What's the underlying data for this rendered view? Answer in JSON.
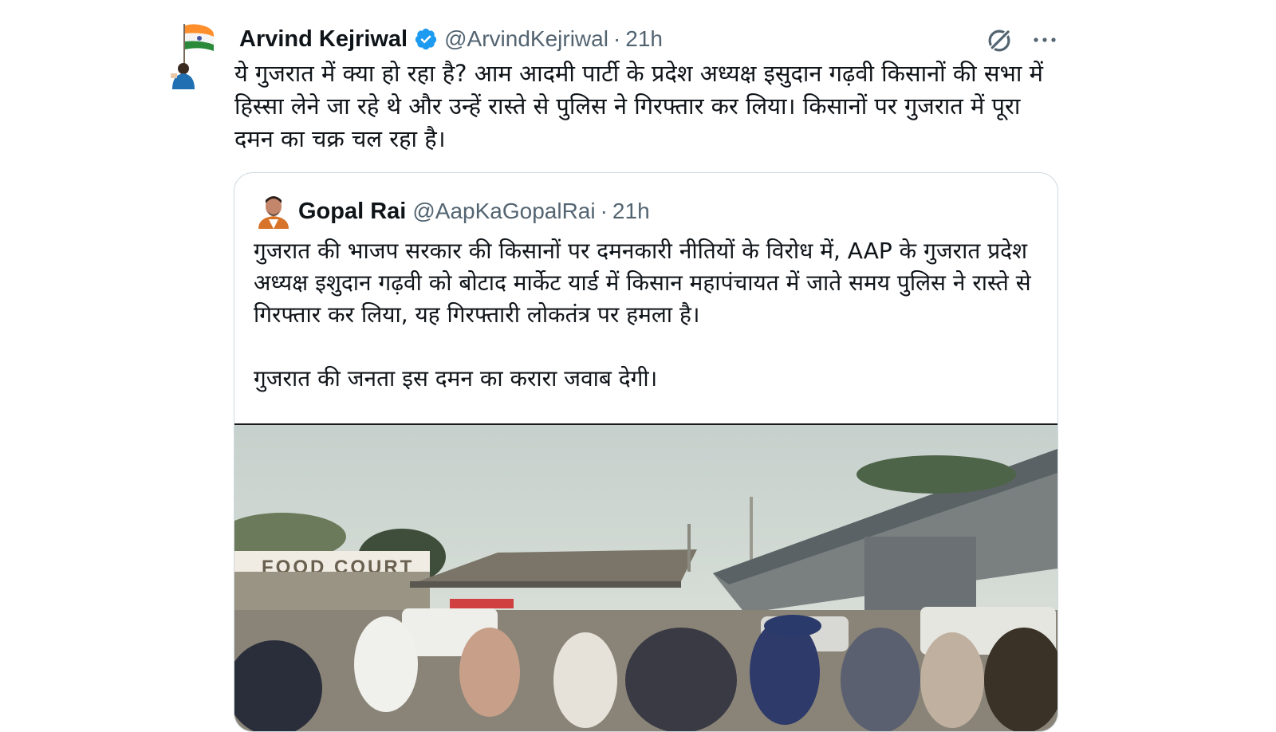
{
  "tweet": {
    "author_name": "Arvind Kejriwal",
    "author_handle": "@ArvindKejriwal",
    "separator": "·",
    "time": "21h",
    "text": "ये गुजरात में क्या हो रहा है? आम आदमी पार्टी के प्रदेश अध्यक्ष इसुदान गढ़वी किसानों की सभा में हिस्सा लेने जा रहे थे और उन्हें रास्ते से पुलिस ने गिरफ्तार कर लिया। किसानों पर गुजरात में पूरा दमन का चक्र चल रहा है।",
    "icons": {
      "verified": "verified-badge-icon",
      "grok": "grok-icon",
      "more": "more-options-icon"
    },
    "colors": {
      "verified": "#1d9bf0",
      "secondary_text": "#536471",
      "border": "#cfd9de"
    }
  },
  "quote": {
    "author_name": "Gopal Rai",
    "author_handle": "@AapKaGopalRai",
    "separator": "·",
    "time": "21h",
    "paragraph1": "गुजरात की भाजप सरकार की किसानों पर दमनकारी नीतियों के विरोध में, AAP के गुजरात प्रदेश अध्यक्ष इशुदान गढ़वी को बोटाद मार्केट यार्ड में किसान महापंचायत में जाते समय पुलिस ने रास्ते से गिरफ्तार कर लिया, यह गिरफ्तारी लोकतंत्र पर हमला है।",
    "paragraph2": "गुजरात की जनता इस दमन का करारा जवाब देगी।",
    "media_sign": "FOOD COURT"
  }
}
